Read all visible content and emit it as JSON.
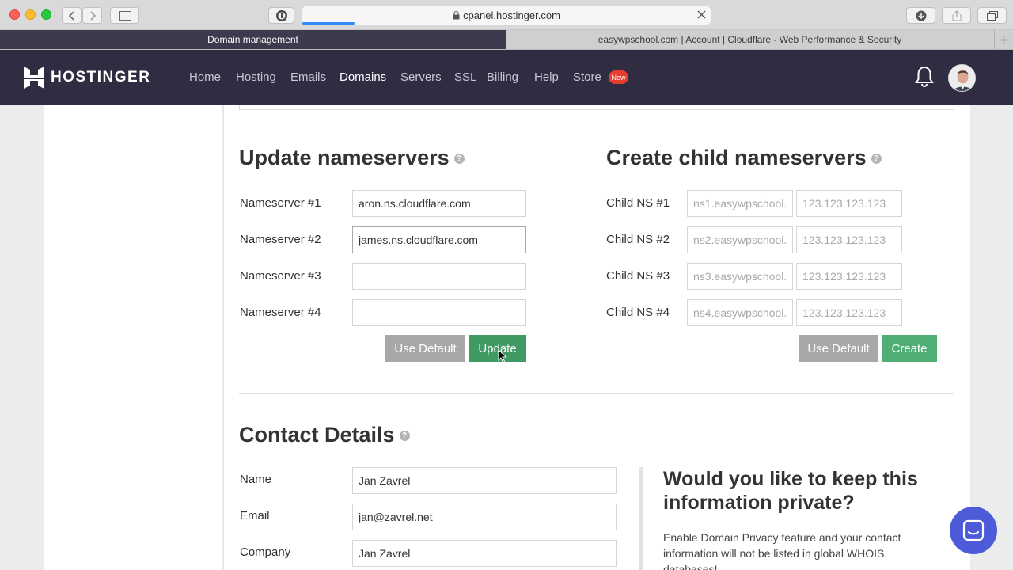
{
  "browser": {
    "url": "cpanel.hostinger.com",
    "tabs": [
      {
        "label": "Domain management",
        "active": true
      },
      {
        "label": "easywpschool.com | Account | Cloudflare - Web Performance & Security",
        "active": false
      }
    ],
    "icons": [
      "back-icon",
      "forward-icon",
      "sidebar-icon",
      "password-manager-icon",
      "lock-icon",
      "close-icon",
      "download-icon",
      "share-icon",
      "tabs-icon",
      "new-tab-icon"
    ]
  },
  "nav": {
    "brand": "HOSTINGER",
    "items": [
      "Home",
      "Hosting",
      "Emails",
      "Domains",
      "Servers",
      "SSL",
      "Billing",
      "Help",
      "Store"
    ],
    "active": "Domains",
    "badge": "New",
    "accent": "#302d42",
    "badge_color": "#e73c2e"
  },
  "nameservers": {
    "title": "Update nameservers",
    "fields": [
      {
        "label": "Nameserver #1",
        "value": "aron.ns.cloudflare.com"
      },
      {
        "label": "Nameserver #2",
        "value": "james.ns.cloudflare.com"
      },
      {
        "label": "Nameserver #3",
        "value": ""
      },
      {
        "label": "Nameserver #4",
        "value": ""
      }
    ],
    "use_default_label": "Use Default",
    "update_label": "Update"
  },
  "child": {
    "title": "Create child nameservers",
    "rows": [
      {
        "label": "Child NS #1",
        "host_placeholder": "ns1.easywpschool.",
        "ip_placeholder": "123.123.123.123"
      },
      {
        "label": "Child NS #2",
        "host_placeholder": "ns2.easywpschool.",
        "ip_placeholder": "123.123.123.123"
      },
      {
        "label": "Child NS #3",
        "host_placeholder": "ns3.easywpschool.",
        "ip_placeholder": "123.123.123.123"
      },
      {
        "label": "Child NS #4",
        "host_placeholder": "ns4.easywpschool.",
        "ip_placeholder": "123.123.123.123"
      }
    ],
    "use_default_label": "Use Default",
    "create_label": "Create"
  },
  "contact": {
    "title": "Contact Details",
    "fields": [
      {
        "label": "Name",
        "value": "Jan Zavrel"
      },
      {
        "label": "Email",
        "value": "jan@zavrel.net"
      },
      {
        "label": "Company",
        "value": "Jan Zavrel"
      }
    ],
    "privacy_title": "Would you like to keep this information private?",
    "privacy_text": "Enable Domain Privacy feature and your contact information will not be listed in global WHOIS databases!"
  },
  "colors": {
    "primary_green": "#4fae74",
    "gray_button": "#a8a8a8",
    "chat": "#4d5bd8"
  }
}
